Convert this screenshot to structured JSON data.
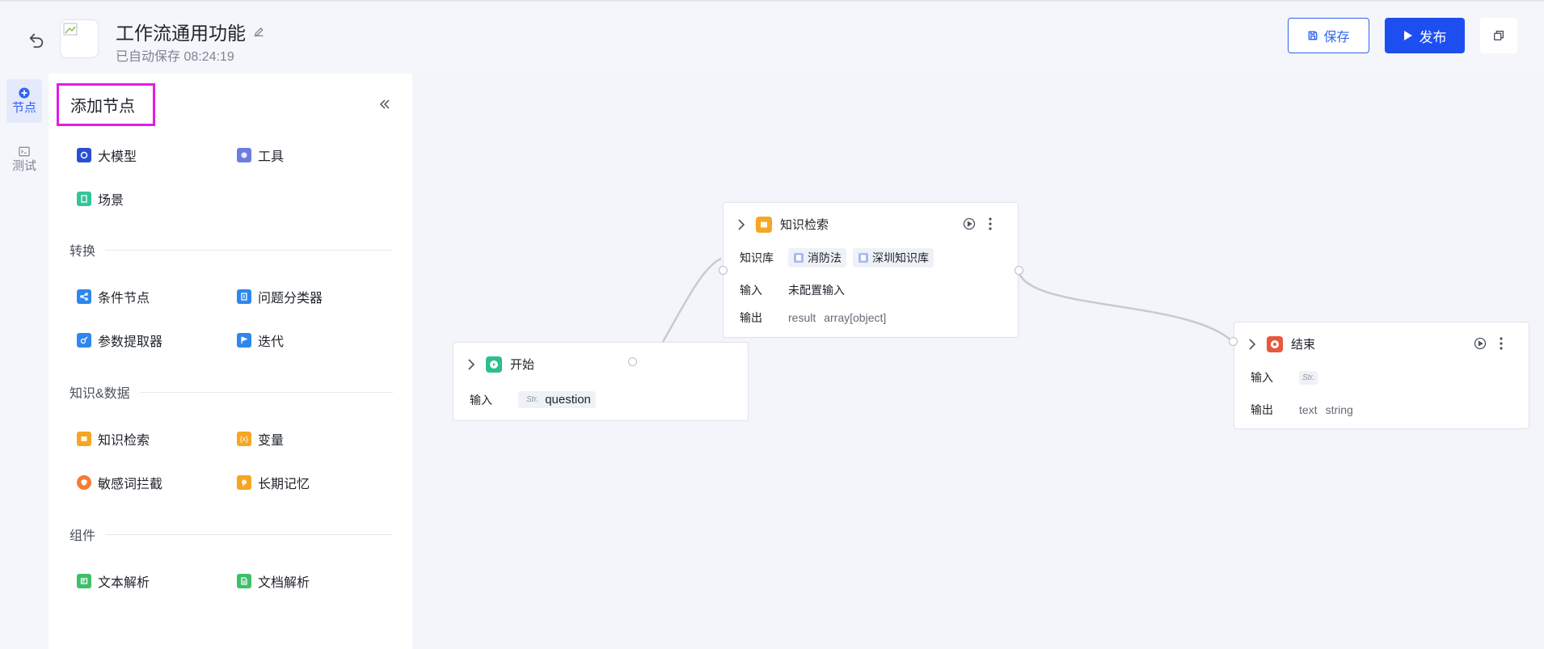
{
  "header": {
    "title": "工作流通用功能",
    "autosave": "已自动保存 08:24:19",
    "save_label": "保存",
    "publish_label": "发布"
  },
  "rail": {
    "items": [
      {
        "label": "节点",
        "icon": "plus-circle-icon",
        "active": true
      },
      {
        "label": "测试",
        "icon": "terminal-icon",
        "active": false
      }
    ]
  },
  "panel": {
    "title": "添加节点",
    "top_items": [
      {
        "label": "大模型",
        "icon": "llm-icon",
        "color": "#2a4fd4"
      },
      {
        "label": "工具",
        "icon": "tool-icon",
        "color": "#6b7de3"
      },
      {
        "label": "场景",
        "icon": "scene-icon",
        "color": "#36c49a"
      }
    ],
    "sections": [
      {
        "title": "转换",
        "items": [
          {
            "label": "条件节点",
            "icon": "branch-icon",
            "color": "#2f86ee"
          },
          {
            "label": "问题分类器",
            "icon": "classifier-icon",
            "color": "#2f86ee"
          },
          {
            "label": "参数提取器",
            "icon": "extractor-icon",
            "color": "#2f86ee"
          },
          {
            "label": "迭代",
            "icon": "flag-icon",
            "color": "#2f86ee"
          }
        ]
      },
      {
        "title": "知识&数据",
        "items": [
          {
            "label": "知识检索",
            "icon": "book-icon",
            "color": "#f5a623"
          },
          {
            "label": "变量",
            "icon": "variable-icon",
            "color": "#f5a623"
          },
          {
            "label": "敏感词拦截",
            "icon": "shield-icon",
            "color": "#f57c35"
          },
          {
            "label": "长期记忆",
            "icon": "memory-icon",
            "color": "#f5a623"
          }
        ]
      },
      {
        "title": "组件",
        "items": [
          {
            "label": "文本解析",
            "icon": "text-parse-icon",
            "color": "#3fbf6b"
          },
          {
            "label": "文档解析",
            "icon": "doc-parse-icon",
            "color": "#3fbf6b"
          }
        ]
      }
    ]
  },
  "nodes": {
    "start": {
      "title": "开始",
      "input_label": "输入",
      "input_type": "Str.",
      "input_value": "question",
      "color": "#2dbf8c"
    },
    "knowledge": {
      "title": "知识检索",
      "kb_label": "知识库",
      "kb_tags": [
        "消防法",
        "深圳知识库"
      ],
      "input_label": "输入",
      "input_value": "未配置输入",
      "output_label": "输出",
      "output_name": "result",
      "output_type": "array[object]",
      "color": "#f5a623"
    },
    "end": {
      "title": "结束",
      "input_label": "输入",
      "input_type": "Str.",
      "output_label": "输出",
      "output_name": "text",
      "output_type": "string",
      "color": "#e8573e"
    }
  },
  "colors": {
    "primary": "#1d4ff0",
    "highlight": "#e21ce7"
  }
}
